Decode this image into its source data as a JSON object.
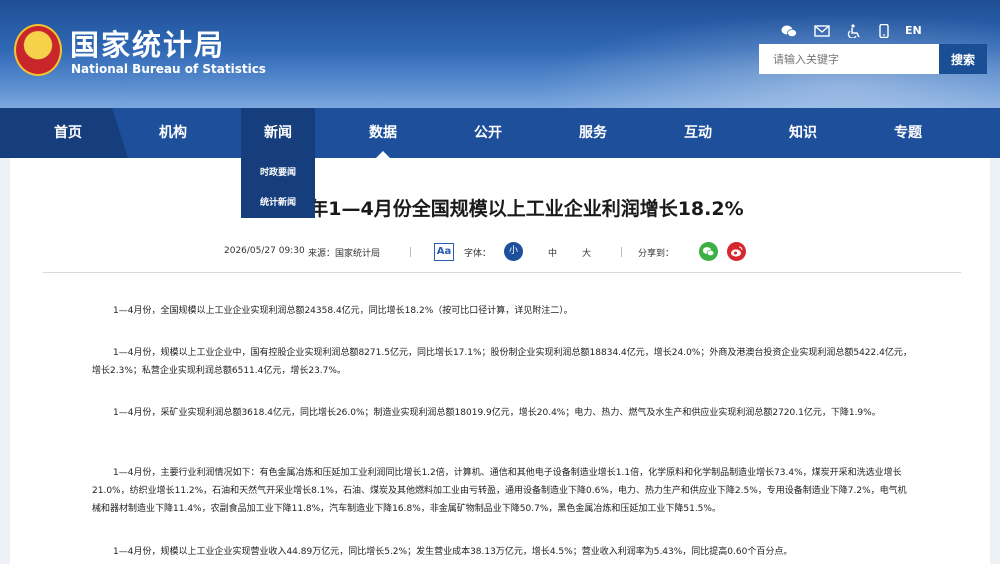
{
  "header": {
    "brand_cn": "国家统计局",
    "brand_en": "National Bureau of Statistics",
    "lang_link": "EN",
    "search_placeholder": "请输入关键字",
    "search_button": "搜索"
  },
  "nav": {
    "items": [
      "首页",
      "机构",
      "新闻",
      "数据",
      "公开",
      "服务",
      "互动",
      "知识",
      "专题"
    ],
    "dropdown": [
      "时政要闻",
      "统计新闻"
    ]
  },
  "article": {
    "title": "2026年1—4月份全国规模以上工业企业利润增长18.2%",
    "date": "2026/05/27 09:30",
    "source": "来源：国家统计局",
    "aa": "Aa",
    "font_label": "字体：",
    "font_small": "小",
    "font_medium": "中",
    "font_large": "大",
    "share_label": "分享到：",
    "paragraphs": [
      "1—4月份，全国规模以上工业企业实现利润总额24358.4亿元，同比增长18.2%（按可比口径计算，详见附注二）。",
      "1—4月份，规模以上工业企业中，国有控股企业实现利润总额8271.5亿元，同比增长17.1%；股份制企业实现利润总额18834.4亿元，增长24.0%；外商及港澳台投资企业实现利润总额5422.4亿元，增长2.3%；私营企业实现利润总额6511.4亿元，增长23.7%。",
      "1—4月份，采矿业实现利润总额3618.4亿元，同比增长26.0%；制造业实现利润总额18019.9亿元，增长20.4%；电力、热力、燃气及水生产和供应业实现利润总额2720.1亿元，下降1.9%。",
      "1—4月份，主要行业利润情况如下：有色金属冶炼和压延加工业利润同比增长1.2倍，计算机、通信和其他电子设备制造业增长1.1倍，化学原料和化学制品制造业增长73.4%，煤炭开采和洗选业增长21.0%，纺织业增长11.2%，石油和天然气开采业增长8.1%，石油、煤炭及其他燃料加工业由亏转盈，通用设备制造业下降0.6%，电力、热力生产和供应业下降2.5%，专用设备制造业下降7.2%，电气机械和器材制造业下降11.4%，农副食品加工业下降11.8%，汽车制造业下降16.8%，非金属矿物制品业下降50.7%，黑色金属冶炼和压延加工业下降51.5%。",
      "1—4月份，规模以上工业企业实现营业收入44.89万亿元，同比增长5.2%；发生营业成本38.13万亿元，增长4.5%；营业收入利润率为5.43%，同比提高0.60个百分点。"
    ]
  }
}
